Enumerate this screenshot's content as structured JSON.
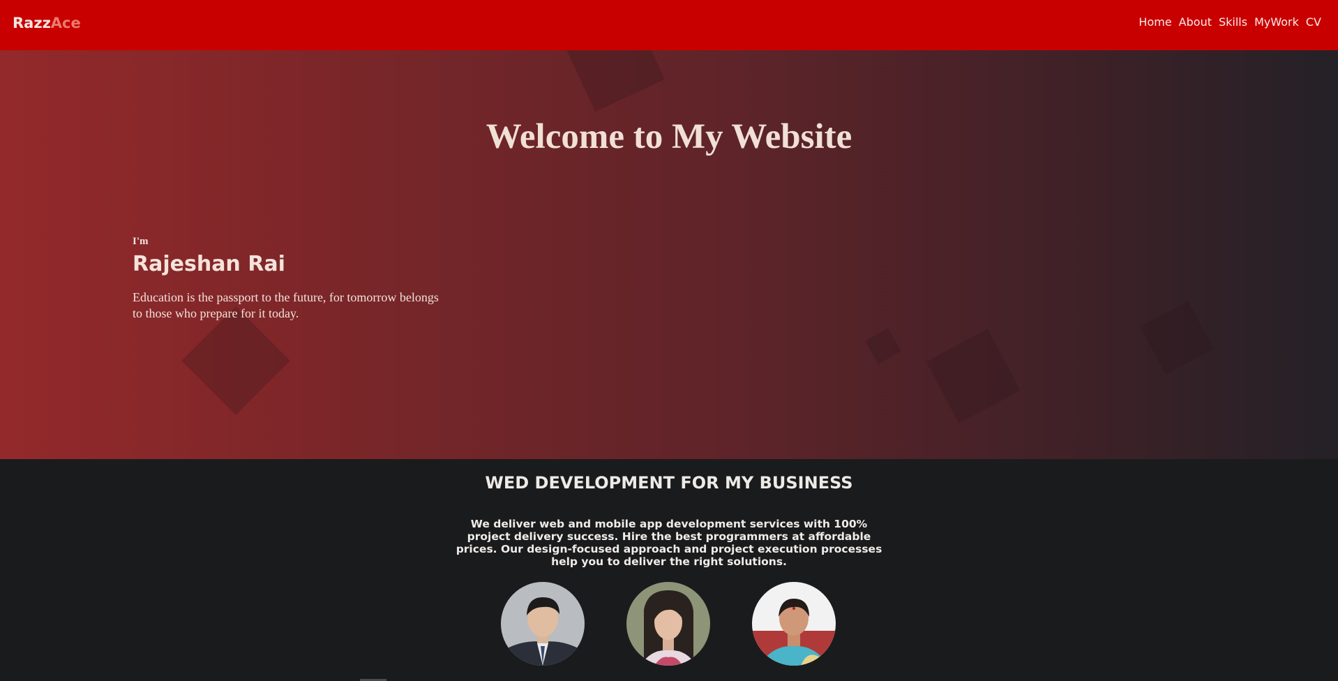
{
  "navbar": {
    "logo_part1": "Razz",
    "logo_part2": "Ace",
    "links": [
      "Home",
      "About",
      "Skills",
      "MyWork",
      "CV"
    ]
  },
  "hero": {
    "title": "Welcome to My Website",
    "greeting": "I'm",
    "name": "Rajeshan Rai",
    "quote": "Education is the passport to the future, for tomorrow belongs to those who prepare for it today."
  },
  "services": {
    "heading": "WED DEVELOPMENT FOR MY BUSINESS",
    "description": "We deliver web and mobile app development services with 100% project delivery success. Hire the best programmers at affordable prices. Our design-focused approach and project execution processes help you to deliver the right solutions."
  },
  "colors": {
    "navbar": "#c90000",
    "hero_gradient_start": "#93292a",
    "hero_gradient_end": "#242127",
    "section_bg": "#1a1b1d",
    "logo_accent": "#ec7a6c"
  }
}
